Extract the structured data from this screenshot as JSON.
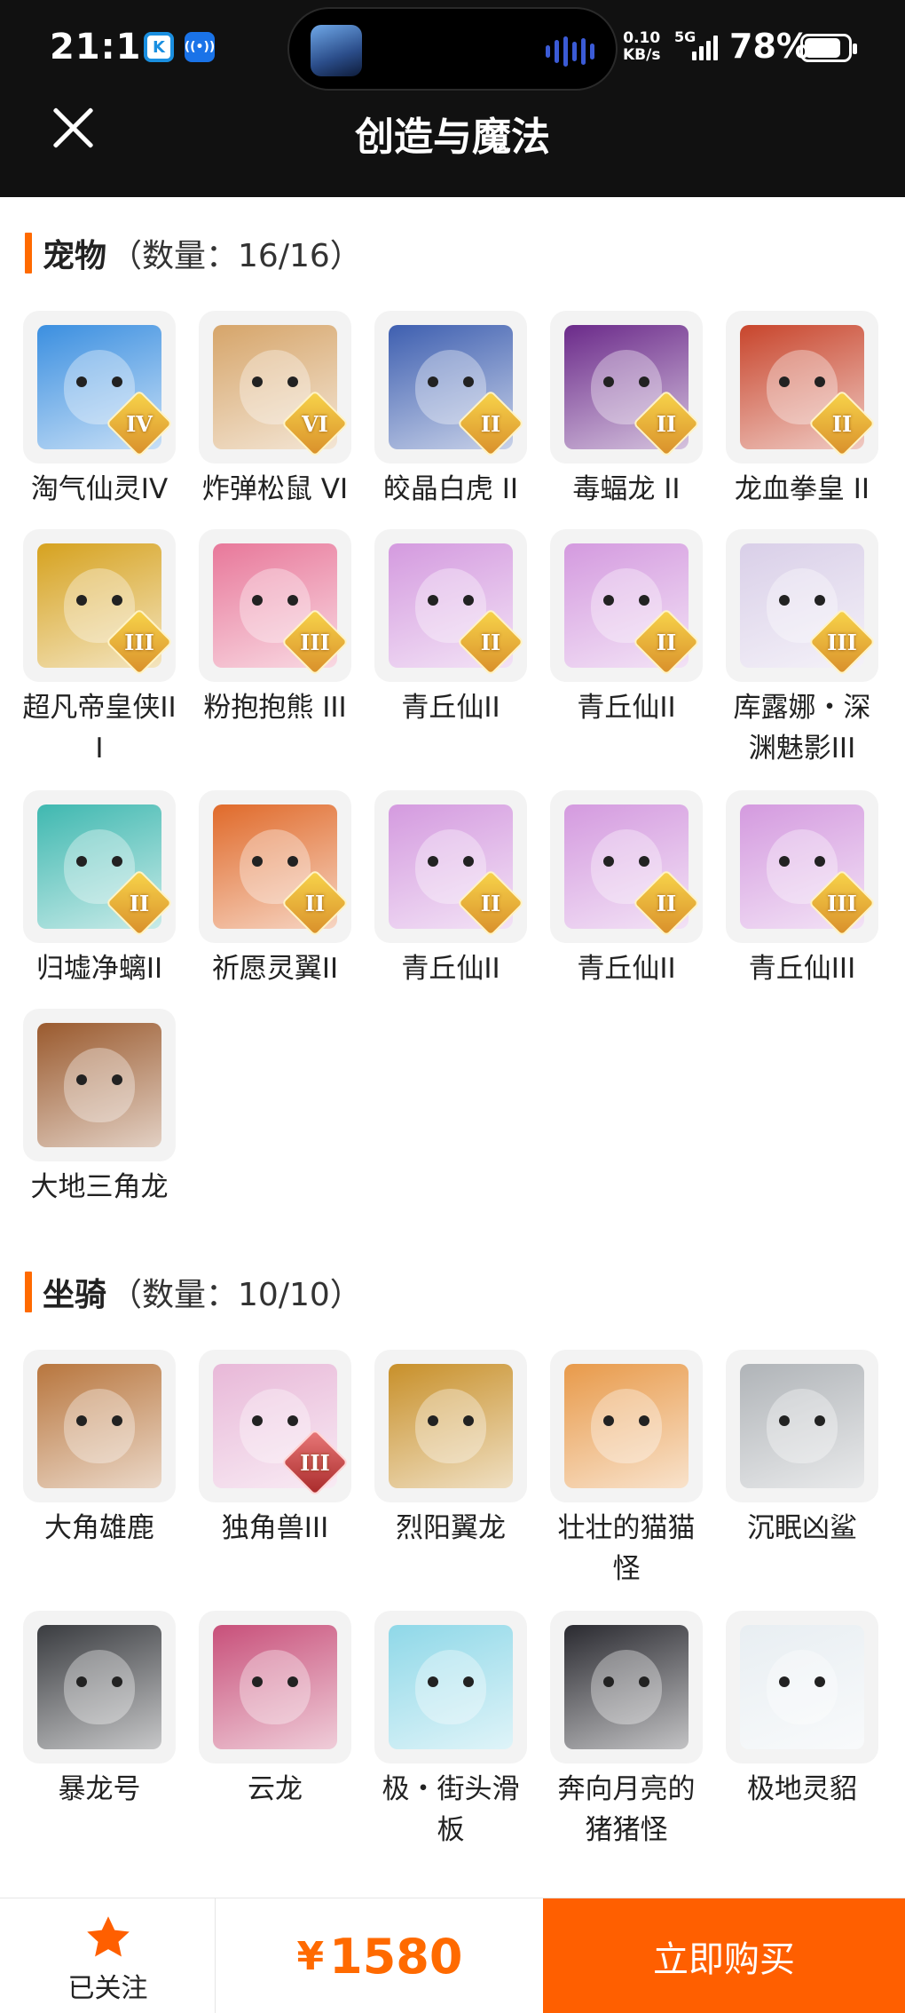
{
  "status_bar": {
    "time": "21:18",
    "app_icons": [
      "k-app-icon",
      "broadcast-icon"
    ],
    "net_speed_value": "0.10",
    "net_speed_unit": "KB/s",
    "network": "5G",
    "battery": "78%"
  },
  "header": {
    "title": "创造与魔法",
    "close_icon": "close-icon"
  },
  "pets": {
    "name": "宠物",
    "count_text": "（数量：16/16）",
    "items": [
      {
        "label": "淘气仙灵IV",
        "rank": "IV",
        "color": "#3b8fe0"
      },
      {
        "label": "炸弹松鼠 VI",
        "rank": "VI",
        "color": "#d6a56a"
      },
      {
        "label": "皎晶白虎 II",
        "rank": "II",
        "color": "#3e5fb0"
      },
      {
        "label": "毒蝠龙 II",
        "rank": "II",
        "color": "#6b2a8a"
      },
      {
        "label": "龙血拳皇 II",
        "rank": "II",
        "color": "#c8452c"
      },
      {
        "label": "超凡帝皇侠III",
        "rank": "III",
        "color": "#d6a21f"
      },
      {
        "label": "粉抱抱熊 III",
        "rank": "III",
        "color": "#e8789a"
      },
      {
        "label": "青丘仙II",
        "rank": "II",
        "color": "#d49adf"
      },
      {
        "label": "青丘仙II",
        "rank": "II",
        "color": "#d49adf"
      },
      {
        "label": "库露娜・深渊魅影III",
        "rank": "III",
        "color": "#d9cfe8"
      },
      {
        "label": "归墟净螭II",
        "rank": "II",
        "color": "#3fb8b0"
      },
      {
        "label": "祈愿灵翼II",
        "rank": "II",
        "color": "#e06a2a"
      },
      {
        "label": "青丘仙II",
        "rank": "II",
        "color": "#d49adf"
      },
      {
        "label": "青丘仙II",
        "rank": "II",
        "color": "#d49adf"
      },
      {
        "label": "青丘仙III",
        "rank": "III",
        "color": "#d49adf"
      },
      {
        "label": "大地三角龙",
        "rank": "",
        "color": "#9a5a2e"
      }
    ]
  },
  "mounts": {
    "name": "坐骑",
    "count_text": "（数量：10/10）",
    "items": [
      {
        "label": "大角雄鹿",
        "rank": "",
        "color": "#b8763e"
      },
      {
        "label": "独角兽III",
        "rank": "III",
        "color": "#e8b8d8"
      },
      {
        "label": "烈阳翼龙",
        "rank": "",
        "color": "#c8902a"
      },
      {
        "label": "壮壮的猫猫怪",
        "rank": "",
        "color": "#e89a4a"
      },
      {
        "label": "沉眠凶鲨",
        "rank": "",
        "color": "#b0b4b8"
      },
      {
        "label": "暴龙号",
        "rank": "",
        "color": "#3a3c40"
      },
      {
        "label": "云龙",
        "rank": "",
        "color": "#c8507a"
      },
      {
        "label": "极・街头滑板",
        "rank": "",
        "color": "#8fd8e8"
      },
      {
        "label": "奔向月亮的猪猪怪",
        "rank": "",
        "color": "#2a2a30"
      },
      {
        "label": "极地灵貂",
        "rank": "",
        "color": "#e8eef2"
      }
    ]
  },
  "bottom_bar": {
    "follow_label": "已关注",
    "follow_icon": "star-icon",
    "price_symbol": "¥",
    "price_value": "1580",
    "buy_label": "立即购买",
    "accent_color": "#ff5f00"
  }
}
